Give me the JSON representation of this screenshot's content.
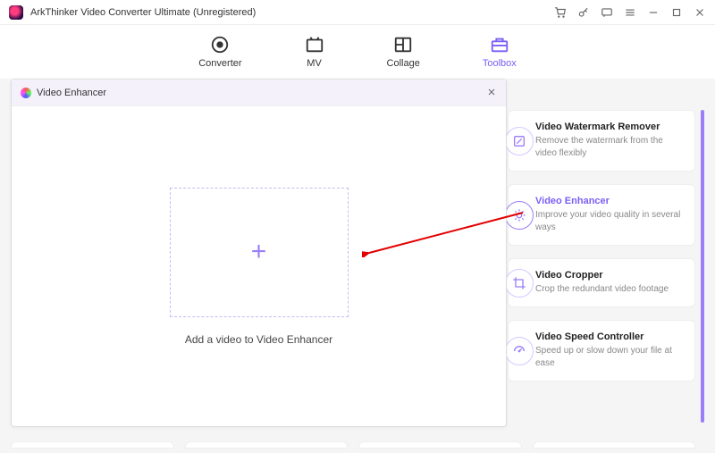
{
  "title": "ArkThinker Video Converter Ultimate (Unregistered)",
  "nav": {
    "converter": "Converter",
    "mv": "MV",
    "collage": "Collage",
    "toolbox": "Toolbox"
  },
  "modal": {
    "title": "Video Enhancer",
    "drop_text": "Add a video to Video Enhancer"
  },
  "tools": [
    {
      "title": "Video Watermark Remover",
      "desc": "Remove the watermark from the video flexibly"
    },
    {
      "title": "Video Enhancer",
      "desc": "Improve your video quality in several ways"
    },
    {
      "title": "Video Cropper",
      "desc": "Crop the redundant video footage"
    },
    {
      "title": "Video Speed Controller",
      "desc": "Speed up or slow down your file at ease"
    }
  ]
}
